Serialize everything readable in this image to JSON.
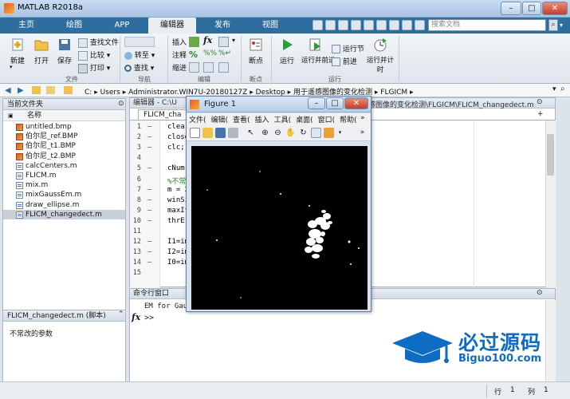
{
  "window": {
    "title": "MATLAB R2018a",
    "min": "–",
    "max": "□",
    "close": "✕"
  },
  "tabs": [
    {
      "label": "主页"
    },
    {
      "label": "绘图"
    },
    {
      "label": "APP"
    },
    {
      "label": "编辑器"
    },
    {
      "label": "发布"
    },
    {
      "label": "视图"
    }
  ],
  "search": {
    "placeholder": "搜索文档"
  },
  "ribbon": {
    "file": {
      "new": "新建",
      "open": "打开",
      "save": "保存",
      "find_files": "查找文件",
      "compare": "比较",
      "print": "打印",
      "group": "文件"
    },
    "nav": {
      "goto": "转至",
      "find": "查找",
      "group": "导航"
    },
    "edit": {
      "insert": "插入",
      "comment": "注释",
      "indent": "缩进",
      "fx": "fx",
      "group": "编辑"
    },
    "breakpoints": {
      "label": "断点",
      "group": "断点"
    },
    "run": {
      "run": "运行",
      "run_advance": "运行并前进",
      "run_section": "运行节",
      "advance": "前进",
      "run_time": "运行并计时",
      "group": "运行"
    }
  },
  "path": {
    "segments": [
      "C:",
      "Users",
      "Administrator.WIN7U-20180127Z",
      "Desktop",
      "用于遥感图像的变化检测",
      "FLGICM"
    ],
    "sep": "▸"
  },
  "current_folder": {
    "title": "当前文件夹",
    "column": "名称",
    "files": [
      {
        "name": "untitled.bmp",
        "type": "img"
      },
      {
        "name": "伯尔尼_ref.BMP",
        "type": "img"
      },
      {
        "name": "伯尔尼_t1.BMP",
        "type": "img"
      },
      {
        "name": "伯尔尼_t2.BMP",
        "type": "img"
      },
      {
        "name": "calcCenters.m",
        "type": "m"
      },
      {
        "name": "FLICM.m",
        "type": "m"
      },
      {
        "name": "mix.m",
        "type": "m"
      },
      {
        "name": "mixGaussEm.m",
        "type": "m"
      },
      {
        "name": "draw_ellipse.m",
        "type": "m"
      },
      {
        "name": "FLICM_changedect.m",
        "type": "m"
      }
    ],
    "details_title": "FLICM_changedect.m (脚本)",
    "details_body": "不常改的参数"
  },
  "editor": {
    "title_left": "编辑器 - C:\\U",
    "title_right": "感图像的变化检测\\FLGICM\\FLICM_changedect.m",
    "tab": "FLICM_cha",
    "lines": [
      {
        "n": "1",
        "d": "—",
        "code": "clear",
        "cm": false
      },
      {
        "n": "2",
        "d": "—",
        "code": "close",
        "cm": false
      },
      {
        "n": "3",
        "d": "—",
        "code": "clc;",
        "cm": false
      },
      {
        "n": "4",
        "d": "",
        "code": "",
        "cm": false
      },
      {
        "n": "5",
        "d": "—",
        "code": "cNum",
        "cm": false
      },
      {
        "n": "6",
        "d": "",
        "code": "%不常",
        "cm": true
      },
      {
        "n": "7",
        "d": "—",
        "code": "m = 2",
        "cm": false
      },
      {
        "n": "8",
        "d": "—",
        "code": "winSi",
        "cm": false
      },
      {
        "n": "9",
        "d": "—",
        "code": "maxIt",
        "cm": false
      },
      {
        "n": "10",
        "d": "—",
        "code": "thrE",
        "cm": false
      },
      {
        "n": "11",
        "d": "",
        "code": "",
        "cm": false
      },
      {
        "n": "12",
        "d": "—",
        "code": "I1=im",
        "cm": false
      },
      {
        "n": "13",
        "d": "—",
        "code": "I2=im",
        "cm": false
      },
      {
        "n": "14",
        "d": "—",
        "code": "I0=im",
        "cm": false
      },
      {
        "n": "15",
        "d": "",
        "code": "",
        "cm": false
      }
    ]
  },
  "command": {
    "title": "命令行窗口",
    "output": "EM for Gaus",
    "fx": "fx",
    "prompt": ">>"
  },
  "figure": {
    "title": "Figure 1",
    "menus": [
      "文件(",
      "编辑(",
      "查看(",
      "插入",
      "工具(",
      "桌面(",
      "窗口(",
      "帮助("
    ],
    "more": "»"
  },
  "status": {
    "row_label": "行",
    "row": "1",
    "col_label": "列",
    "col": "1"
  },
  "watermark": {
    "cn": "必过源码",
    "en": "Biguo100.com"
  },
  "colors": {
    "tab_bar": "#2f6d9e",
    "accent": "#0e6cc4",
    "figure_bg": "#000000"
  }
}
